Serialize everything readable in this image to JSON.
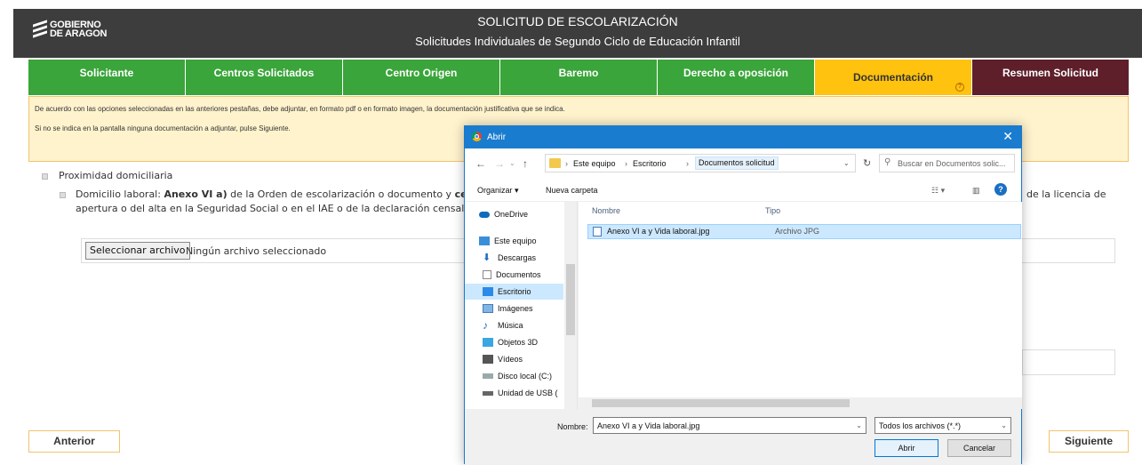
{
  "header": {
    "logo_line1": "GOBIERNO",
    "logo_line2": "DE ARAGON",
    "title": "SOLICITUD DE ESCOLARIZACIÓN",
    "subtitle": "Solicitudes Individuales de Segundo Ciclo de Educación Infantil"
  },
  "tabs": [
    {
      "label": "Solicitante"
    },
    {
      "label": "Centros Solicitados"
    },
    {
      "label": "Centro Origen"
    },
    {
      "label": "Baremo"
    },
    {
      "label": "Derecho a oposición"
    },
    {
      "label": "Documentación",
      "active": true
    },
    {
      "label": "Resumen Solicitud"
    }
  ],
  "info": {
    "line1": "De acuerdo con las opciones seleccionadas en las anteriores pestañas, debe adjuntar, en formato pdf o en formato imagen, la documentación justificativa que se indica.",
    "line2": "Si no se indica en la pantalla ninguna documentación a adjuntar, pulse Siguiente."
  },
  "doc": {
    "section_label": "Proximidad domiciliaria",
    "item_prefix": "Domicilio laboral: ",
    "item_bold1": "Anexo VI a)",
    "item_mid": " de la Orden de escolarización o documento y ",
    "item_bold2": "certifi",
    "item_line2": "apertura o del alta en la Seguridad Social o en el IAE o de la declaración censal de a",
    "item_right": "de la licencia de",
    "file_button": "Seleccionar archivo",
    "file_none": "Ningún archivo seleccionado"
  },
  "nav": {
    "prev": "Anterior",
    "next": "Siguiente"
  },
  "dialog": {
    "title": "Abrir",
    "close": "✕",
    "breadcrumb": [
      "Este equipo",
      "Escritorio",
      "Documentos solicitud"
    ],
    "search_placeholder": "Buscar en Documentos solic...",
    "organize": "Organizar ▾",
    "new_folder": "Nueva carpeta",
    "nav_items": [
      {
        "label": "OneDrive",
        "icon": "cloud-icon"
      },
      {
        "label": "Este equipo",
        "icon": "computer-icon"
      },
      {
        "label": "Descargas",
        "icon": "download-icon"
      },
      {
        "label": "Documentos",
        "icon": "document-icon"
      },
      {
        "label": "Escritorio",
        "icon": "desktop-icon",
        "selected": true
      },
      {
        "label": "Imágenes",
        "icon": "image-icon"
      },
      {
        "label": "Música",
        "icon": "music-icon"
      },
      {
        "label": "Objetos 3D",
        "icon": "cube-icon"
      },
      {
        "label": "Vídeos",
        "icon": "video-icon"
      },
      {
        "label": "Disco local (C:)",
        "icon": "drive-icon"
      },
      {
        "label": "Unidad de USB (",
        "icon": "usb-icon"
      }
    ],
    "col_name": "Nombre",
    "col_type": "Tipo",
    "files": [
      {
        "name": "Anexo VI a y Vida laboral.jpg",
        "type": "Archivo JPG"
      }
    ],
    "name_label": "Nombre:",
    "name_value": "Anexo VI a y Vida laboral.jpg",
    "filter": "Todos los archivos (*.*)",
    "open": "Abrir",
    "cancel": "Cancelar"
  },
  "colors": {
    "tab_green": "#3aa53a",
    "tab_active": "#ffc20e",
    "tab_last": "#5e1f2a",
    "dialog_blue": "#1a7ccf"
  }
}
